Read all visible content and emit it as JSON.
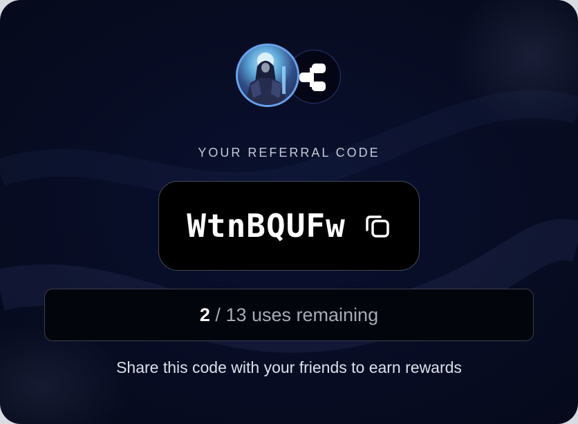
{
  "referral": {
    "label": "YOUR REFERRAL CODE",
    "code": "WtnBQUFw",
    "copy_icon": "copy-icon",
    "uses_used": "2",
    "uses_separator": " / ",
    "uses_total": "13",
    "uses_suffix": " uses remaining",
    "share_text": "Share this code with your friends to earn rewards"
  },
  "avatars": {
    "user_icon": "user-avatar",
    "app_icon": "share-node-icon"
  },
  "colors": {
    "background": "#070c22",
    "avatar_ring": "#6aa2ee",
    "code_box_bg": "#000000",
    "text_primary": "#ffffff",
    "text_muted": "#a7abb8"
  }
}
